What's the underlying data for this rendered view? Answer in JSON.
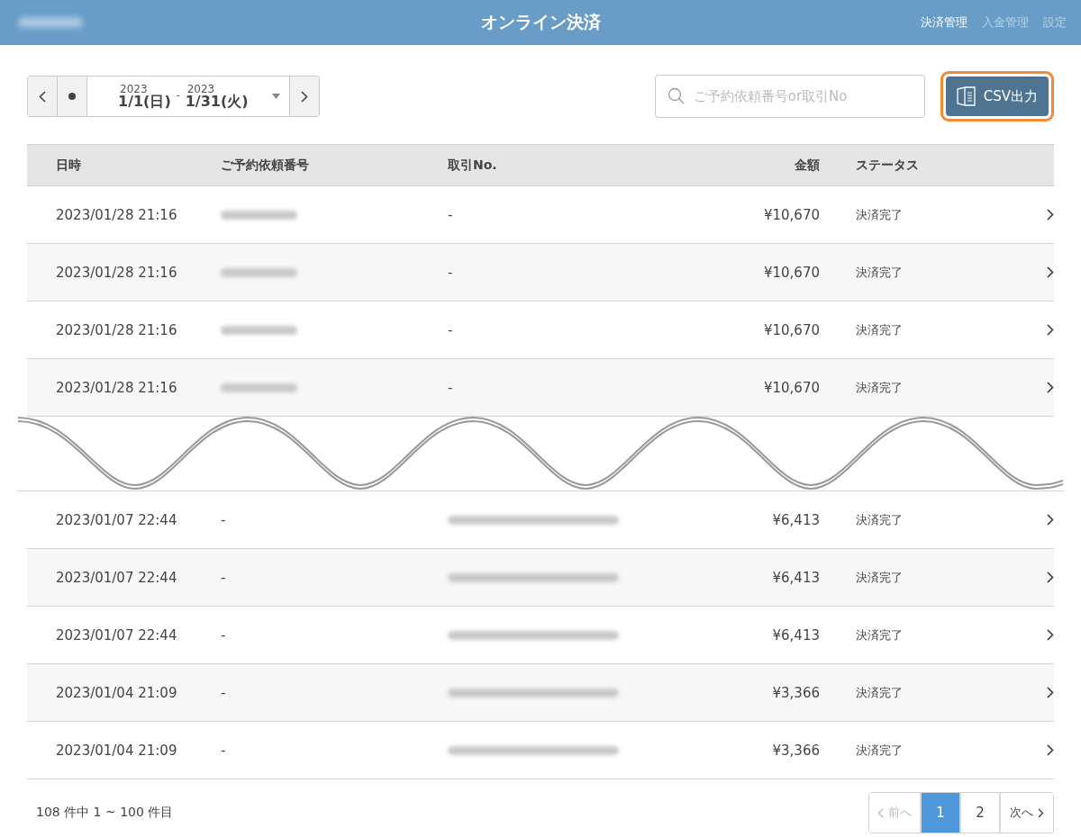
{
  "header": {
    "title": "オンライン決済",
    "nav": [
      {
        "label": "決済管理",
        "selected": true
      },
      {
        "label": "入金管理",
        "selected": false
      },
      {
        "label": "設定",
        "selected": false
      }
    ]
  },
  "date_range": {
    "start_year": "2023",
    "start": "1/1(日)",
    "separator": "-",
    "end_year": "2023",
    "end": "1/31(火)"
  },
  "search": {
    "placeholder": "ご予約依頼番号or取引No"
  },
  "csv_button": {
    "label": "CSV出力",
    "highlighted": true
  },
  "table": {
    "columns": [
      "日時",
      "ご予約依頼番号",
      "取引No.",
      "金額",
      "ステータス"
    ],
    "rows": [
      {
        "datetime": "2023/01/28 21:16",
        "booking_blurred": true,
        "transaction_no": "-",
        "amount": "¥10,670",
        "status": "決済完了"
      },
      {
        "datetime": "2023/01/28 21:16",
        "booking_blurred": true,
        "transaction_no": "-",
        "amount": "¥10,670",
        "status": "決済完了"
      },
      {
        "datetime": "2023/01/28 21:16",
        "booking_blurred": true,
        "transaction_no": "-",
        "amount": "¥10,670",
        "status": "決済完了"
      },
      {
        "datetime": "2023/01/28 21:16",
        "booking_blurred": true,
        "transaction_no": "-",
        "amount": "¥10,670",
        "status": "決済完了"
      },
      {
        "kind": "break"
      },
      {
        "datetime": "2023/01/07 22:44",
        "booking_no": "-",
        "transaction_blurred": true,
        "amount": "¥6,413",
        "status": "決済完了"
      },
      {
        "datetime": "2023/01/07 22:44",
        "booking_no": "-",
        "transaction_blurred": true,
        "amount": "¥6,413",
        "status": "決済完了"
      },
      {
        "datetime": "2023/01/07 22:44",
        "booking_no": "-",
        "transaction_blurred": true,
        "amount": "¥6,413",
        "status": "決済完了"
      },
      {
        "datetime": "2023/01/04 21:09",
        "booking_no": "-",
        "transaction_blurred": true,
        "amount": "¥3,366",
        "status": "決済完了"
      },
      {
        "datetime": "2023/01/04 21:09",
        "booking_no": "-",
        "transaction_blurred": true,
        "amount": "¥3,366",
        "status": "決済完了"
      }
    ]
  },
  "footer": {
    "summary": "108 件中 1 ~ 100 件目",
    "prev": {
      "label": "前へ",
      "disabled": true
    },
    "pages": [
      {
        "label": "1",
        "selected": true
      },
      {
        "label": "2",
        "selected": false
      }
    ],
    "next": {
      "label": "次へ",
      "disabled": false
    }
  }
}
